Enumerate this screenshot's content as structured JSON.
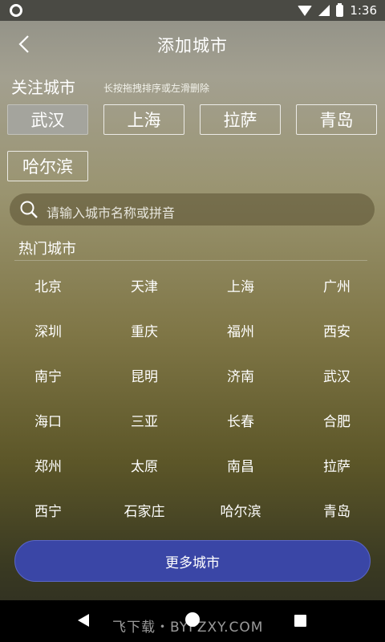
{
  "status_bar": {
    "time": "1:36"
  },
  "header": {
    "title": "添加城市"
  },
  "followed": {
    "title": "关注城市",
    "hint": "长按拖拽排序或左滑删除",
    "cities": [
      "武汉",
      "上海",
      "拉萨",
      "青岛",
      "哈尔滨"
    ],
    "selected": "武汉"
  },
  "search": {
    "placeholder": "请输入城市名称或拼音"
  },
  "hot": {
    "title": "热门城市",
    "cities": [
      "北京",
      "天津",
      "上海",
      "广州",
      "深圳",
      "重庆",
      "福州",
      "西安",
      "南宁",
      "昆明",
      "济南",
      "武汉",
      "海口",
      "三亚",
      "长春",
      "合肥",
      "郑州",
      "太原",
      "南昌",
      "拉萨",
      "西宁",
      "石家庄",
      "哈尔滨",
      "青岛"
    ]
  },
  "more_button": {
    "label": "更多城市"
  },
  "watermark": "飞下载・BYFZXY.COM"
}
